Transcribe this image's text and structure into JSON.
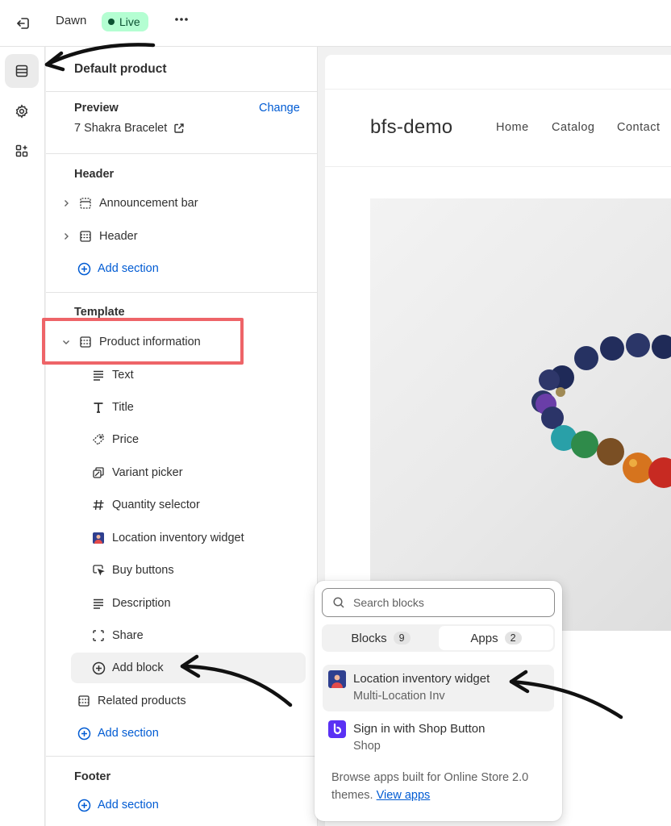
{
  "topbar": {
    "theme_name": "Dawn",
    "live_label": "Live",
    "more_label": "•••",
    "icons": [
      "exit-icon",
      "more-icon"
    ]
  },
  "rail": {
    "items": [
      "sections-icon",
      "settings-icon",
      "apps-icon"
    ],
    "active": "sections-icon"
  },
  "sidebar": {
    "title": "Default product",
    "preview": {
      "heading": "Preview",
      "change_label": "Change",
      "product": "7 Shakra Bracelet"
    },
    "header_group": {
      "heading": "Header",
      "sections": [
        "Announcement bar",
        "Header"
      ],
      "add_section": "Add section"
    },
    "template_group": {
      "heading": "Template",
      "section": "Product information",
      "blocks": [
        {
          "label": "Text",
          "icon": "text-icon"
        },
        {
          "label": "Title",
          "icon": "title-icon"
        },
        {
          "label": "Price",
          "icon": "price-tag-icon"
        },
        {
          "label": "Variant picker",
          "icon": "variant-icon"
        },
        {
          "label": "Quantity selector",
          "icon": "hash-icon"
        },
        {
          "label": "Location inventory widget",
          "icon": "app-block-icon"
        },
        {
          "label": "Buy buttons",
          "icon": "cursor-button-icon"
        },
        {
          "label": "Description",
          "icon": "text-icon"
        },
        {
          "label": "Share",
          "icon": "share-icon"
        }
      ],
      "add_block": "Add block",
      "related": "Related products",
      "add_section": "Add section"
    },
    "footer_group": {
      "heading": "Footer",
      "add_section": "Add section"
    }
  },
  "store": {
    "brand": "bfs-demo",
    "nav": [
      "Home",
      "Catalog",
      "Contact"
    ]
  },
  "popover": {
    "search_placeholder": "Search blocks",
    "tabs": [
      {
        "label": "Blocks",
        "count": "9"
      },
      {
        "label": "Apps",
        "count": "2"
      }
    ],
    "active_tab": "Apps",
    "apps": [
      {
        "name": "Location inventory widget",
        "source": "Multi-Location Inv"
      },
      {
        "name": "Sign in with Shop Button",
        "source": "Shop"
      }
    ],
    "browse_text": "Browse apps built for Online Store 2.0 themes.",
    "browse_link": "View apps"
  },
  "colors": {
    "accent": "#005bd3",
    "live_bg": "#b4fed2",
    "highlight_box": "#ee6468",
    "shop_purple": "#5a31f4"
  }
}
